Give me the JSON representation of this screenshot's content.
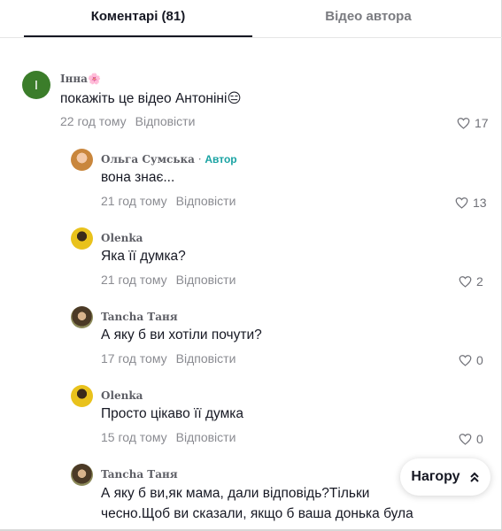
{
  "tabs": {
    "comments_label": "Коментарі (81)",
    "author_videos_label": "Відео автора"
  },
  "comments": [
    {
      "username": "Інна",
      "username_emoji": "🌸",
      "avatar_letter": "I",
      "text": "покажіть це відео Антоніні😑",
      "time": "22 год тому",
      "reply_label": "Відповісти",
      "likes": "17"
    }
  ],
  "replies": [
    {
      "username": "Ольга Сумська",
      "author_tag": "Автор",
      "text": "вона знає...",
      "time": "21 год тому",
      "reply_label": "Відповісти",
      "likes": "13"
    },
    {
      "username": "Olenka",
      "text": "Яка її думка?",
      "time": "21 год тому",
      "reply_label": "Відповісти",
      "likes": "2"
    },
    {
      "username": "Tancha Таня",
      "text": "А яку б ви хотіли почути?",
      "time": "17 год тому",
      "reply_label": "Відповісти",
      "likes": "0"
    },
    {
      "username": "Olenka",
      "text": "Просто цікаво її думка",
      "time": "15 год тому",
      "reply_label": "Відповісти",
      "likes": "0"
    },
    {
      "username": "Tancha Таня",
      "text_line1": "А яку б ви,як мама, дали відповідь?Тільки",
      "text_line2": "чесно.Щоб ви сказали, якщо б ваша донька була"
    }
  ],
  "back_to_top": {
    "label": "Нагору",
    "icon": "double-chevron-up-icon"
  },
  "colors": {
    "accent_author": "#1aa3a3",
    "avatar_green": "#3b7d2a",
    "text_primary": "#161823",
    "text_secondary": "#8a8b91"
  }
}
